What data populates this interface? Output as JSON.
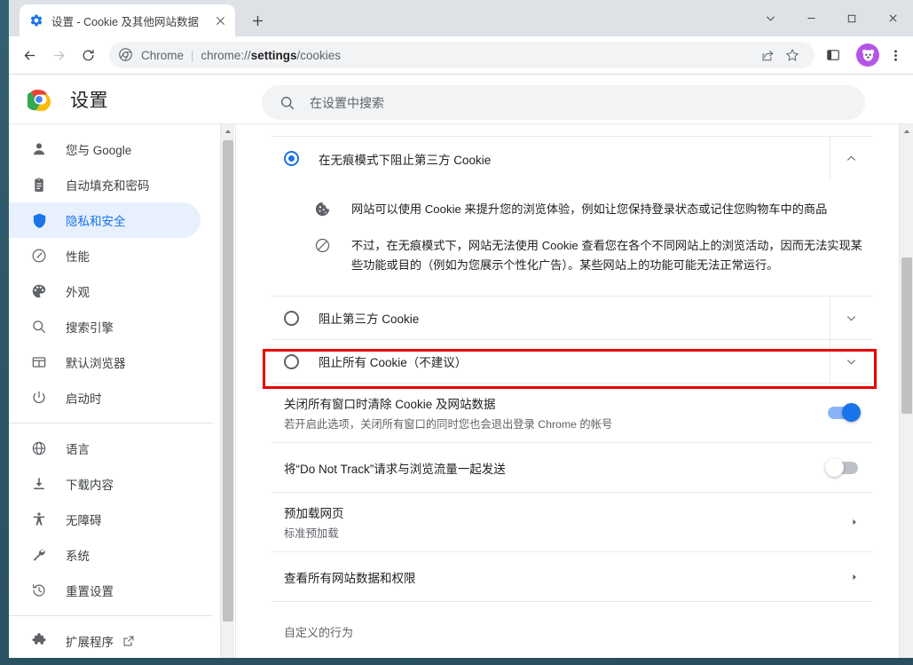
{
  "window": {
    "controls": {
      "expand": "chevron-down",
      "minimize": "—",
      "maximize": "□",
      "close": "✕"
    }
  },
  "tab": {
    "title": "设置 - Cookie 及其他网站数据",
    "favicon": "settings-gear-icon",
    "close_label": "✕",
    "newtab_label": "+"
  },
  "toolbar": {
    "back": "←",
    "forward": "→",
    "reload": "⟳",
    "omnibox": {
      "scheme_icon": "chrome-logo-icon",
      "scheme_text": "Chrome",
      "separator": "|",
      "url_prefix": "chrome://",
      "url_bold": "settings",
      "url_suffix": "/cookies",
      "full_url": "chrome://settings/cookies"
    },
    "share": "share-icon",
    "bookmark": "star-icon",
    "sidepanel": "side-panel-icon",
    "avatar": "profile-avatar-panda",
    "menu": "three-dot-menu"
  },
  "settings_header": {
    "logo": "chrome-logo",
    "title": "设置",
    "search_placeholder": "在设置中搜索",
    "search_value": ""
  },
  "sidebar": {
    "groups": [
      {
        "items": [
          {
            "label": "您与 Google",
            "icon": "person-icon",
            "selected": false
          },
          {
            "label": "自动填充和密码",
            "icon": "clipboard-icon",
            "selected": false
          },
          {
            "label": "隐私和安全",
            "icon": "shield-icon",
            "selected": true
          },
          {
            "label": "性能",
            "icon": "speedometer-icon",
            "selected": false
          },
          {
            "label": "外观",
            "icon": "palette-icon",
            "selected": false
          },
          {
            "label": "搜索引擎",
            "icon": "search-icon",
            "selected": false
          },
          {
            "label": "默认浏览器",
            "icon": "browser-window-icon",
            "selected": false
          },
          {
            "label": "启动时",
            "icon": "power-icon",
            "selected": false
          }
        ]
      },
      {
        "items": [
          {
            "label": "语言",
            "icon": "globe-icon",
            "selected": false
          },
          {
            "label": "下载内容",
            "icon": "download-icon",
            "selected": false
          },
          {
            "label": "无障碍",
            "icon": "accessibility-icon",
            "selected": false
          },
          {
            "label": "系统",
            "icon": "wrench-icon",
            "selected": false
          },
          {
            "label": "重置设置",
            "icon": "history-restore-icon",
            "selected": false
          }
        ]
      },
      {
        "items": [
          {
            "label": "扩展程序",
            "icon": "puzzle-icon",
            "selected": false,
            "external": true
          }
        ]
      }
    ]
  },
  "content": {
    "cookie_options": [
      {
        "label": "在无痕模式下阻止第三方 Cookie",
        "selected": true,
        "expanded": true,
        "chevron": "chevron-up",
        "details": [
          {
            "icon": "cookie-icon",
            "text": "网站可以使用 Cookie 来提升您的浏览体验，例如让您保持登录状态或记住您购物车中的商品"
          },
          {
            "icon": "block-icon",
            "text": "不过，在无痕模式下，网站无法使用 Cookie 查看您在各个不同网站上的浏览活动，因而无法实现某些功能或目的（例如为您展示个性化广告）。某些网站上的功能可能无法正常运行。"
          }
        ]
      },
      {
        "label": "阻止第三方 Cookie",
        "selected": false,
        "expanded": false,
        "chevron": "chevron-down",
        "details": []
      },
      {
        "label": "阻止所有 Cookie（不建议）",
        "selected": false,
        "expanded": false,
        "chevron": "chevron-down",
        "highlighted": true,
        "details": []
      }
    ],
    "toggles": [
      {
        "title": "关闭所有窗口时清除 Cookie 及网站数据",
        "subtitle": "若开启此选项，关闭所有窗口的同时您也会退出登录 Chrome 的帐号",
        "state": "on"
      },
      {
        "title": "将“Do Not Track”请求与浏览流量一起发送",
        "subtitle": "",
        "state": "off"
      }
    ],
    "links": [
      {
        "title": "预加载网页",
        "subtitle": "标准预加载",
        "arrow": "chevron-right"
      },
      {
        "title": "查看所有网站数据和权限",
        "subtitle": "",
        "arrow": "chevron-right"
      }
    ],
    "section_label": "自定义的行为"
  },
  "colors": {
    "accent": "#1a73e8",
    "selected_bg": "#e8f0fe",
    "highlight_red": "#e80000",
    "toggle_on_track": "#8ab4f8",
    "toggle_off_track": "#bdc1c6",
    "avatar_bg": "#b455e8"
  }
}
